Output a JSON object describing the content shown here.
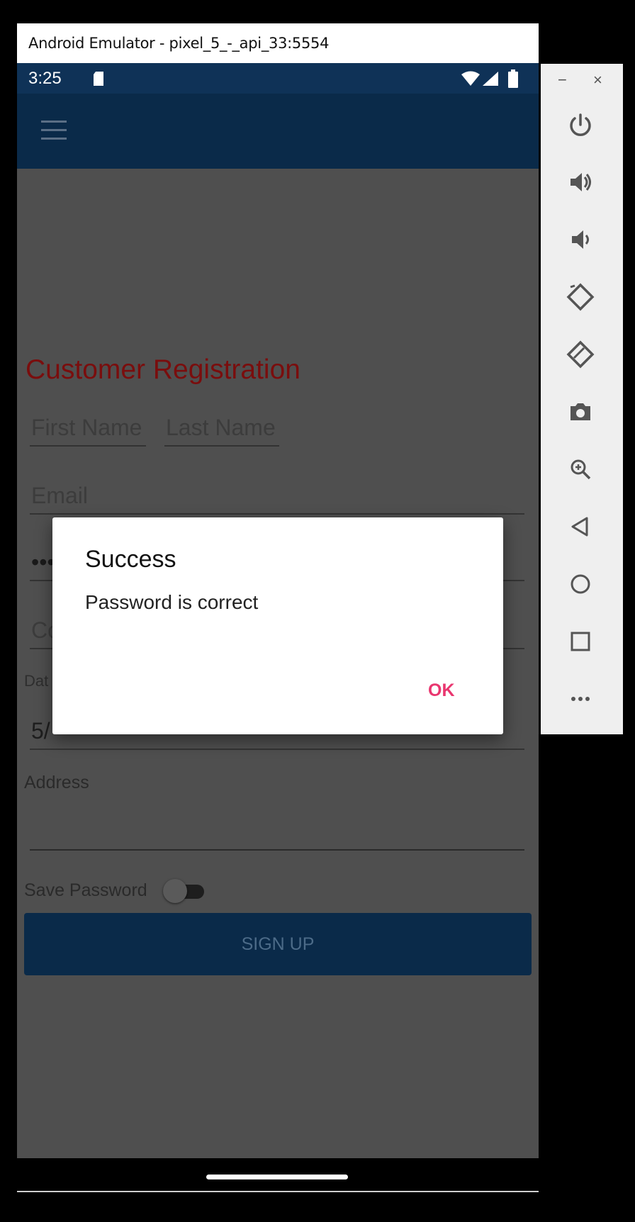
{
  "window": {
    "title": "Android Emulator - pixel_5_-_api_33:5554"
  },
  "status_bar": {
    "time": "3:25",
    "icons": [
      "sd-card-icon",
      "wifi-icon",
      "signal-icon",
      "battery-icon"
    ]
  },
  "app_bar": {
    "menu_icon": "hamburger-menu-icon",
    "background": "#0a2a49"
  },
  "form": {
    "title": "Customer Registration",
    "title_color": "#7a0d0d",
    "first_name_placeholder": "First Name",
    "last_name_placeholder": "Last Name",
    "email_placeholder": "Email",
    "password_value": "•••",
    "confirm_partial": "Co",
    "date_label_partial": "Dat",
    "date_value_partial": "5/",
    "address_label": "Address",
    "address_value": "",
    "save_password_label": "Save Password",
    "save_password_on": false,
    "signup_label": "SIGN UP"
  },
  "dialog": {
    "title": "Success",
    "message": "Password is correct",
    "ok_label": "OK",
    "ok_color": "#e9366f"
  },
  "emulator_toolbar": {
    "minimize": "−",
    "close": "×",
    "buttons": [
      "power-icon",
      "volume-up-icon",
      "volume-down-icon",
      "rotate-left-icon",
      "rotate-right-icon",
      "camera-icon",
      "zoom-icon",
      "back-icon",
      "home-icon",
      "overview-icon",
      "more-icon"
    ]
  }
}
